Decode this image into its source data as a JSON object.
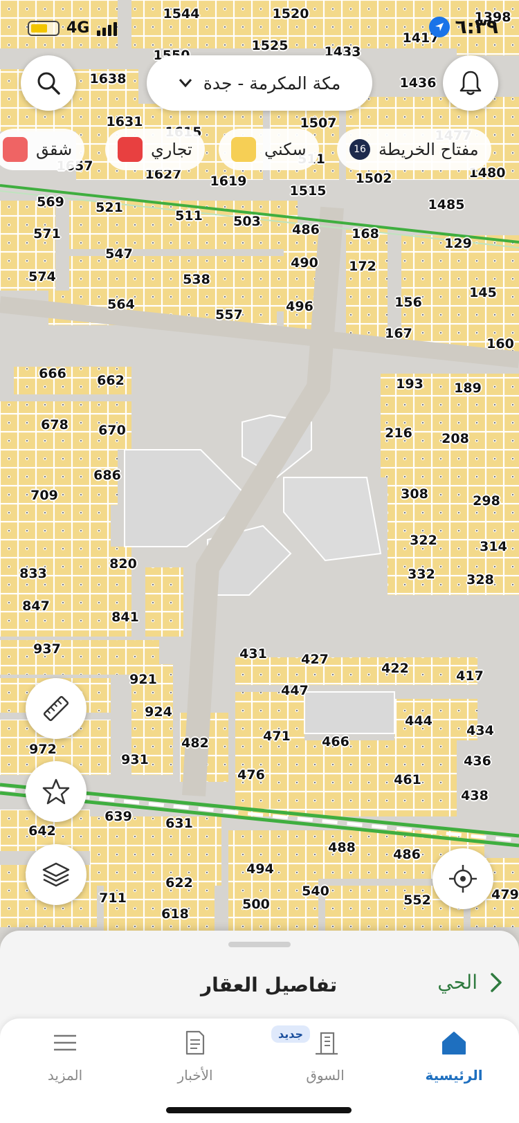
{
  "status_bar": {
    "network": "4G",
    "time": "٦:٣٩",
    "battery_level": 0.6
  },
  "header": {
    "city_label": "مكة المكرمة - جدة"
  },
  "legend": {
    "key_label": "مفتاح الخريطة",
    "zoom": "16",
    "items": [
      {
        "label": "سكني",
        "color": "#f6cf55"
      },
      {
        "label": "تجاري",
        "color": "#e84040"
      },
      {
        "label": "شقق",
        "color": "#ef6464"
      }
    ]
  },
  "map": {
    "plot_numbers": [
      "1544",
      "1520",
      "1398",
      "1550",
      "1525",
      "1433",
      "1417",
      "1638",
      "1436",
      "1631",
      "1507",
      "1615",
      "1477",
      "1657",
      "1627",
      "1619",
      "511",
      "1480",
      "1502",
      "1515",
      "1485",
      "569",
      "521",
      "511",
      "503",
      "486",
      "168",
      "571",
      "547",
      "490",
      "172",
      "129",
      "574",
      "538",
      "145",
      "564",
      "557",
      "496",
      "156",
      "167",
      "160",
      "666",
      "662",
      "193",
      "189",
      "678",
      "670",
      "216",
      "208",
      "686",
      "308",
      "298",
      "709",
      "322",
      "314",
      "833",
      "820",
      "332",
      "328",
      "847",
      "841",
      "937",
      "431",
      "427",
      "422",
      "417",
      "921",
      "447",
      "924",
      "444",
      "434",
      "972",
      "482",
      "471",
      "466",
      "931",
      "436",
      "476",
      "461",
      "438",
      "639",
      "631",
      "642",
      "488",
      "486",
      "494",
      "622",
      "540",
      "552",
      "711",
      "618",
      "500",
      "479"
    ],
    "colors": {
      "residential": "#f6cf55",
      "road": "#d8d4cc",
      "green_line": "#3fae3f"
    }
  },
  "sheet": {
    "title": "تفاصيل العقار",
    "district_link": "الحي"
  },
  "tabs": [
    {
      "label": "الرئيسية",
      "icon": "home-icon"
    },
    {
      "label": "السوق",
      "icon": "building-icon",
      "badge": "جديد"
    },
    {
      "label": "الأخبار",
      "icon": "news-icon"
    },
    {
      "label": "المزيد",
      "icon": "menu-icon"
    }
  ]
}
